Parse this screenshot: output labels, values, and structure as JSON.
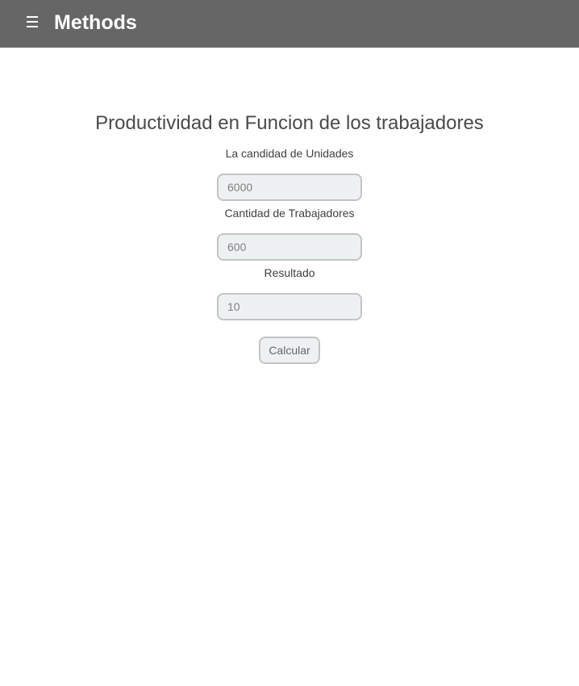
{
  "header": {
    "title": "Methods",
    "menu_icon": "hamburger-menu-icon",
    "background_color": "#666666"
  },
  "form": {
    "title": "Productividad en Funcion de los trabajadores",
    "fields": [
      {
        "label": "La candidad de Unidades",
        "placeholder": "6000"
      },
      {
        "label": "Cantidad de Trabajadores",
        "placeholder": "600"
      },
      {
        "label": "Resultado",
        "placeholder": "10"
      }
    ],
    "button_label": "Calcular"
  }
}
